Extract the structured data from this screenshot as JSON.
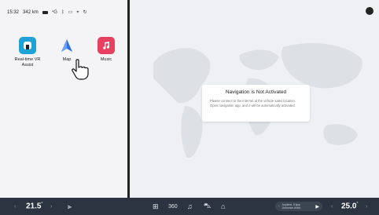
{
  "status_bar": {
    "time": "15:32",
    "range": "342 km",
    "icons": [
      "battery-icon",
      "signal-icon",
      "bluetooth-icon",
      "camera-icon",
      "location-icon",
      "sync-icon"
    ]
  },
  "apps": [
    {
      "label": "Real-time VR\nAssist",
      "icon": "vr-assist-icon",
      "color": "#1fa3d6"
    },
    {
      "label": "Map",
      "icon": "map-arrow-icon",
      "color": "#2f6fe0"
    },
    {
      "label": "Music",
      "icon": "music-note-icon",
      "color": "#e84060"
    }
  ],
  "dialog": {
    "title": "Navigation is Not Activated",
    "body": "Please connect to the internet at the vehicle sales location. Open navigation app, and it will be automatically activated."
  },
  "bottom_bar": {
    "left_temp": "21.5",
    "left_temp_unit": "°",
    "right_temp": "25.0",
    "right_temp_unit": "°",
    "media_line1": "Anytime, Enjoy",
    "media_line2": "Unknown Artist",
    "icons": [
      "fan-volume-icon",
      "apps-grid-icon",
      "360-camera-icon",
      "music-icon",
      "car-icon",
      "home-icon"
    ]
  },
  "colors": {
    "bottom_bar_bg": "#2b3440",
    "divider": "#222222",
    "map_bg": "#eef0f3"
  }
}
